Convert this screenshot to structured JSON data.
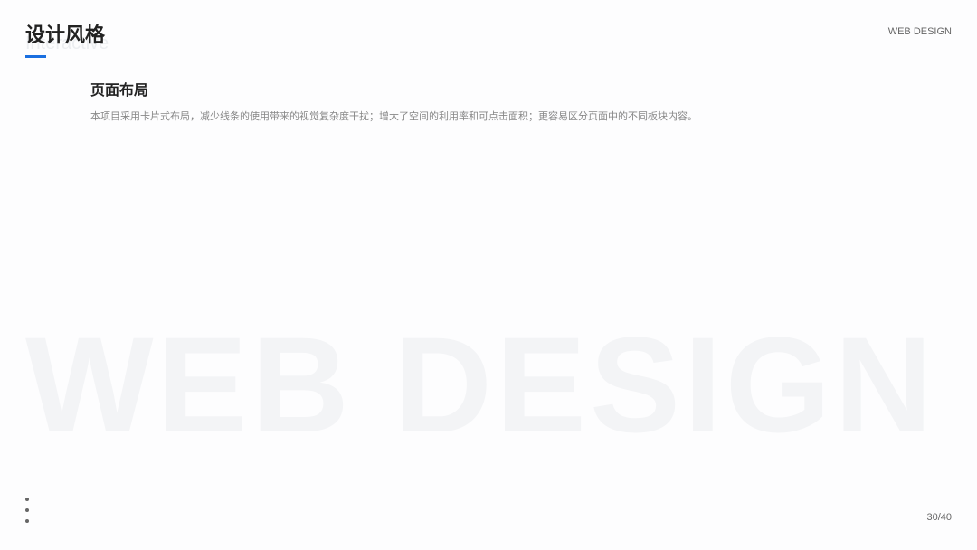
{
  "watermark": "WEB DESIGN",
  "header": {
    "title": "设计风格",
    "subtitle": "Interactive",
    "tag": "WEB DESIGN"
  },
  "section": {
    "heading": "页面布局",
    "body": "本项目采用卡片式布局，减少线条的使用带来的视觉复杂度干扰；增大了空间的利用率和可点击面积；更容易区分页面中的不同板块内容。"
  },
  "page": "30/40",
  "accent": "#1a6fe0"
}
